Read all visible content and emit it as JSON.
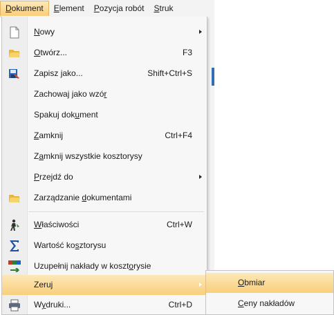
{
  "menubar": {
    "items": [
      {
        "label": "Dokument",
        "key": "D",
        "rest": "okument"
      },
      {
        "label": "Element",
        "key": "E",
        "rest": "lement"
      },
      {
        "label": "Pozycja robót",
        "key": "P",
        "rest": "ozycja robót"
      },
      {
        "label": "Strukt",
        "key": "S",
        "rest": "truk"
      }
    ]
  },
  "menu": {
    "new": {
      "pre": "",
      "key": "N",
      "post": "owy",
      "icon": "new-document-icon"
    },
    "open": {
      "pre": "",
      "key": "O",
      "post": "twórz...",
      "shortcut": "F3",
      "icon": "folder-open-icon"
    },
    "save_as": {
      "pre": "Zapisz ",
      "key": "j",
      "post": "ako...",
      "shortcut": "Shift+Ctrl+S",
      "icon": "save-as-icon"
    },
    "save_template": {
      "pre": "Zachowaj jako wzó",
      "key": "r",
      "post": ""
    },
    "pack": {
      "pre": "Spakuj dok",
      "key": "u",
      "post": "ment"
    },
    "close": {
      "pre": "",
      "key": "Z",
      "post": "amknij",
      "shortcut": "Ctrl+F4"
    },
    "close_all": {
      "pre": "Z",
      "key": "a",
      "post": "mknij wszystkie kosztorysy"
    },
    "goto": {
      "pre": "",
      "key": "P",
      "post": "rzejdź do"
    },
    "manage": {
      "pre": "Zarządzanie ",
      "key": "d",
      "post": "okumentami",
      "icon": "folder-manage-icon"
    },
    "properties": {
      "pre": "",
      "key": "W",
      "post": "łaściwości",
      "shortcut": "Ctrl+W",
      "icon": "properties-icon"
    },
    "value": {
      "pre": "Wartość ko",
      "key": "s",
      "post": "ztorysu",
      "icon": "sum-icon"
    },
    "fill": {
      "pre": "Uzupełnij nakłady w koszt",
      "key": "o",
      "post": "rysie",
      "icon": "rms-icon"
    },
    "reset": {
      "pre": "Zeruj",
      "key": "",
      "post": ""
    },
    "prints": {
      "pre": "W",
      "key": "y",
      "post": "druki...",
      "shortcut": "Ctrl+D",
      "icon": "printer-icon"
    }
  },
  "submenu": {
    "items": [
      {
        "pre": "",
        "key": "O",
        "post": "bmiar"
      },
      {
        "pre": "",
        "key": "C",
        "post": "eny nakładów"
      }
    ]
  },
  "colors": {
    "highlight_top": "#fde8b8",
    "highlight_bottom": "#f8cf7c",
    "accent": "#2f6fb6"
  }
}
